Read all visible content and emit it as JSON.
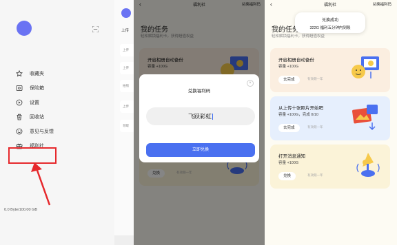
{
  "drawer": {
    "menu": [
      {
        "label": "收藏夹",
        "icon": "star-icon"
      },
      {
        "label": "保险箱",
        "icon": "safe-icon"
      },
      {
        "label": "设置",
        "icon": "settings-icon"
      },
      {
        "label": "回收站",
        "icon": "trash-icon"
      },
      {
        "label": "意见与反馈",
        "icon": "feedback-icon"
      },
      {
        "label": "福利社",
        "icon": "gift-icon"
      }
    ],
    "storage": "0.0 Byte/100.00 GB",
    "behind": {
      "upload_label": "上传",
      "chips": [
        "上传",
        "上传",
        "拍照",
        "上传",
        "领取"
      ]
    }
  },
  "page": {
    "title": "福利社",
    "right_action": "兑换福利码",
    "heading": "我的任务",
    "subtitle": "轻松解锁福利卡，获得超值权益",
    "expiry": "有效期一年"
  },
  "tasks": [
    {
      "title": "开启相册自动备份",
      "reward": "容量 +100G",
      "button": "去完成",
      "color": "#fbeee0"
    },
    {
      "title": "从上传十张照片开始吧",
      "reward": "容量 +100G，完成 0/10",
      "button": "去完成",
      "color": "#e6effd"
    },
    {
      "title": "打开消息通知",
      "reward": "容量 +100G",
      "button": "兑换",
      "color": "#fbf3d8"
    }
  ],
  "modal": {
    "title": "兑换福利码",
    "code": "飞跃彩虹",
    "submit": "立即兑换",
    "card_button": "兑换"
  },
  "toast": {
    "line1": "兑换成功",
    "line2": "322G 福利五分钟内到账"
  },
  "colors": {
    "accent": "#4a70f0",
    "avatar": "#6a73f3",
    "highlight": "#e6282c"
  }
}
